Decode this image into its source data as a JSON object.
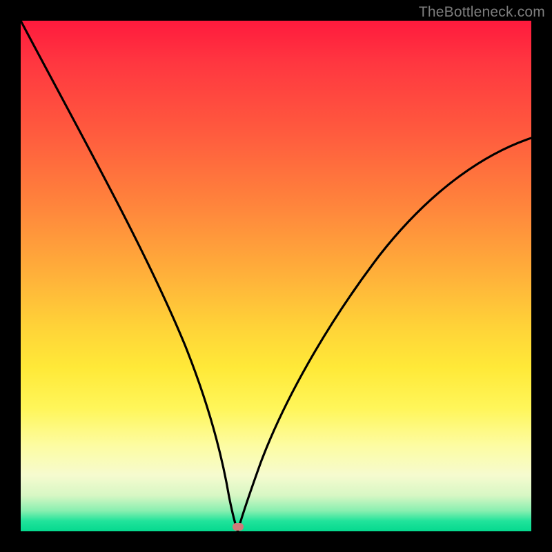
{
  "watermark": "TheBottleneck.com",
  "marker": {
    "x_pct": 42.5,
    "y_pct": 99.1
  },
  "chart_data": {
    "type": "line",
    "title": "",
    "xlabel": "",
    "ylabel": "",
    "xlim": [
      0,
      100
    ],
    "ylim": [
      0,
      100
    ],
    "grid": false,
    "legend": false,
    "background_gradient": {
      "top_color": "#ff1a3d",
      "bottom_color": "#05d98e",
      "meaning": "heat from red (high bottleneck) to green (low bottleneck)"
    },
    "series": [
      {
        "name": "bottleneck-curve",
        "color": "#000000",
        "x": [
          0,
          5,
          10,
          15,
          20,
          25,
          30,
          33,
          36,
          38,
          40,
          41,
          42.5,
          44,
          46,
          50,
          55,
          60,
          65,
          70,
          75,
          80,
          85,
          90,
          95,
          100
        ],
        "values": [
          100,
          88,
          76,
          64,
          52,
          41,
          30,
          22,
          14,
          9,
          5,
          2.5,
          0,
          3,
          8,
          16,
          25,
          33,
          40,
          47,
          53,
          59,
          64,
          69,
          73,
          77
        ]
      }
    ],
    "marker_point": {
      "x": 42.5,
      "y": 0,
      "color": "#d07a7a",
      "shape": "rounded-rect"
    }
  }
}
